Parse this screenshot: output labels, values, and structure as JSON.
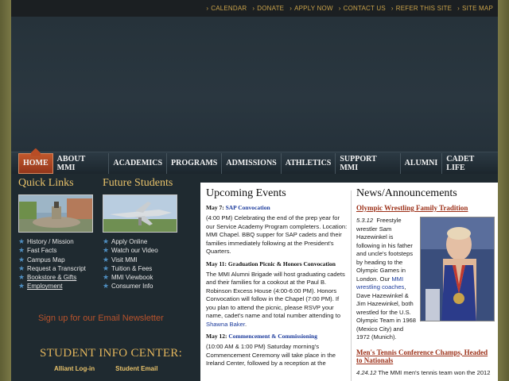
{
  "topbar": {
    "links": [
      "CALENDAR",
      "DONATE",
      "APPLY NOW",
      "CONTACT US",
      "REFER THIS SITE",
      "SITE MAP"
    ]
  },
  "nav": {
    "items": [
      "HOME",
      "ABOUT MMI",
      "ACADEMICS",
      "PROGRAMS",
      "ADMISSIONS",
      "ATHLETICS",
      "SUPPORT MMI",
      "ALUMNI",
      "CADET LIFE"
    ],
    "active": "HOME"
  },
  "quick_links": {
    "title": "Quick Links",
    "items": [
      "History / Mission",
      "Fast Facts",
      "Campus Map",
      "Request a Transcript",
      "Bookstore & Gifts",
      "Employment"
    ]
  },
  "future_students": {
    "title": "Future Students",
    "items": [
      "Apply Online",
      "Watch our Video",
      "Visit MMI",
      "Tuition & Fees",
      "MMI Viewbook",
      "Consumer Info"
    ]
  },
  "newsletter": "Sign up for our Email Newsletter",
  "student_info": {
    "title": "STUDENT INFO CENTER:",
    "links": [
      "Alliant Log-in",
      "Student Email"
    ]
  },
  "events": {
    "title": "Upcoming Events",
    "items": [
      {
        "date": "May 7:",
        "link": "SAP Convocation",
        "body": "(4:00 PM) Celebrating the end of the prep year for our Service Academy Program completers. Location: MMI Chapel. BBQ supper for SAP cadets and their families immediately following at the President's Quarters."
      },
      {
        "date": "May 11:",
        "link": "Graduation Picnic & Honors Convocation",
        "body": "The MMI Alumni Brigade will host graduating cadets and their families for a cookout at the Paul B. Robinson Excess House (4:00-6:00 PM). Honors Convocation will follow in the Chapel (7:00 PM). If you plan to attend the picnic, please RSVP your name, cadet's name and total number attending to",
        "body_link": "Shawna Baker",
        "body_end": "."
      },
      {
        "date": "May 12:",
        "link": "Commencement & Commissioning",
        "body": "(10:00 AM & 1:00 PM) Saturday morning's Commencement Ceremony will take place in the Ireland Center, followed by a reception at the"
      }
    ]
  },
  "news": {
    "title": "News/Announcements",
    "items": [
      {
        "headline": "Olympic Wrestling Family Tradition",
        "date": "5.3.12",
        "text1": "Freestyle wrestler Sam Hazewinkel is following in his father and uncle's footsteps by heading to the Olympic Games in London. Our",
        "link": "MMI wrestling coaches",
        "text2": ", Dave Hazewinkel & Jim Hazewinkel, both wrestled for the U.S. Olympic Team in 1968 (Mexico City) and 1972 (Munich)."
      },
      {
        "headline": "Men's Tennis Conference Champs, Headed to Nationals",
        "date": "4.24.12",
        "text1": "The MMI men's tennis team won the 2012"
      }
    ]
  }
}
